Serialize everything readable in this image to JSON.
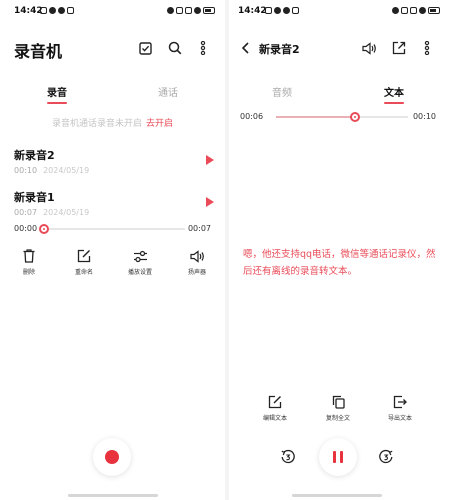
{
  "colors": {
    "accent": "#e94b58",
    "record": "#e8323e"
  },
  "left": {
    "status": {
      "time": "14:42"
    },
    "title": "录音机",
    "header_icons": [
      "checkbox-icon",
      "search-icon",
      "more-vertical-icon"
    ],
    "tabs": [
      {
        "label": "录音",
        "active": true
      },
      {
        "label": "通话",
        "active": false
      }
    ],
    "notice": {
      "text": "录音机通话录音未开启",
      "link": "去开启"
    },
    "recordings": [
      {
        "name": "新录音2",
        "duration": "00:10",
        "date": "2024/05/19"
      },
      {
        "name": "新录音1",
        "duration": "00:07",
        "date": "2024/05/19"
      }
    ],
    "player": {
      "current": "00:00",
      "total": "00:07",
      "progress": 0
    },
    "actions": [
      {
        "label": "删除",
        "icon": "trash-icon"
      },
      {
        "label": "重命名",
        "icon": "edit-icon"
      },
      {
        "label": "播放设置",
        "icon": "sliders-icon"
      },
      {
        "label": "扬声器",
        "icon": "speaker-icon"
      }
    ],
    "record_button": "record-icon"
  },
  "right": {
    "status": {
      "time": "14:42"
    },
    "title": "新录音2",
    "header_icons": [
      "back-icon",
      "speaker-icon",
      "share-icon",
      "more-vertical-icon"
    ],
    "tabs": [
      {
        "label": "音频",
        "active": false
      },
      {
        "label": "文本",
        "active": true
      }
    ],
    "player": {
      "current": "00:06",
      "total": "00:10",
      "progress": 0.6
    },
    "transcript": "嗯，他还支持qq电话，微信等通话记录仪，然后还有离线的录音转文本。",
    "actions": [
      {
        "label": "编辑文本",
        "icon": "edit-icon"
      },
      {
        "label": "复制全文",
        "icon": "copy-icon"
      },
      {
        "label": "导出文本",
        "icon": "export-icon"
      }
    ],
    "controls": [
      "rewind-3s-icon",
      "pause-icon",
      "forward-3s-icon"
    ]
  }
}
